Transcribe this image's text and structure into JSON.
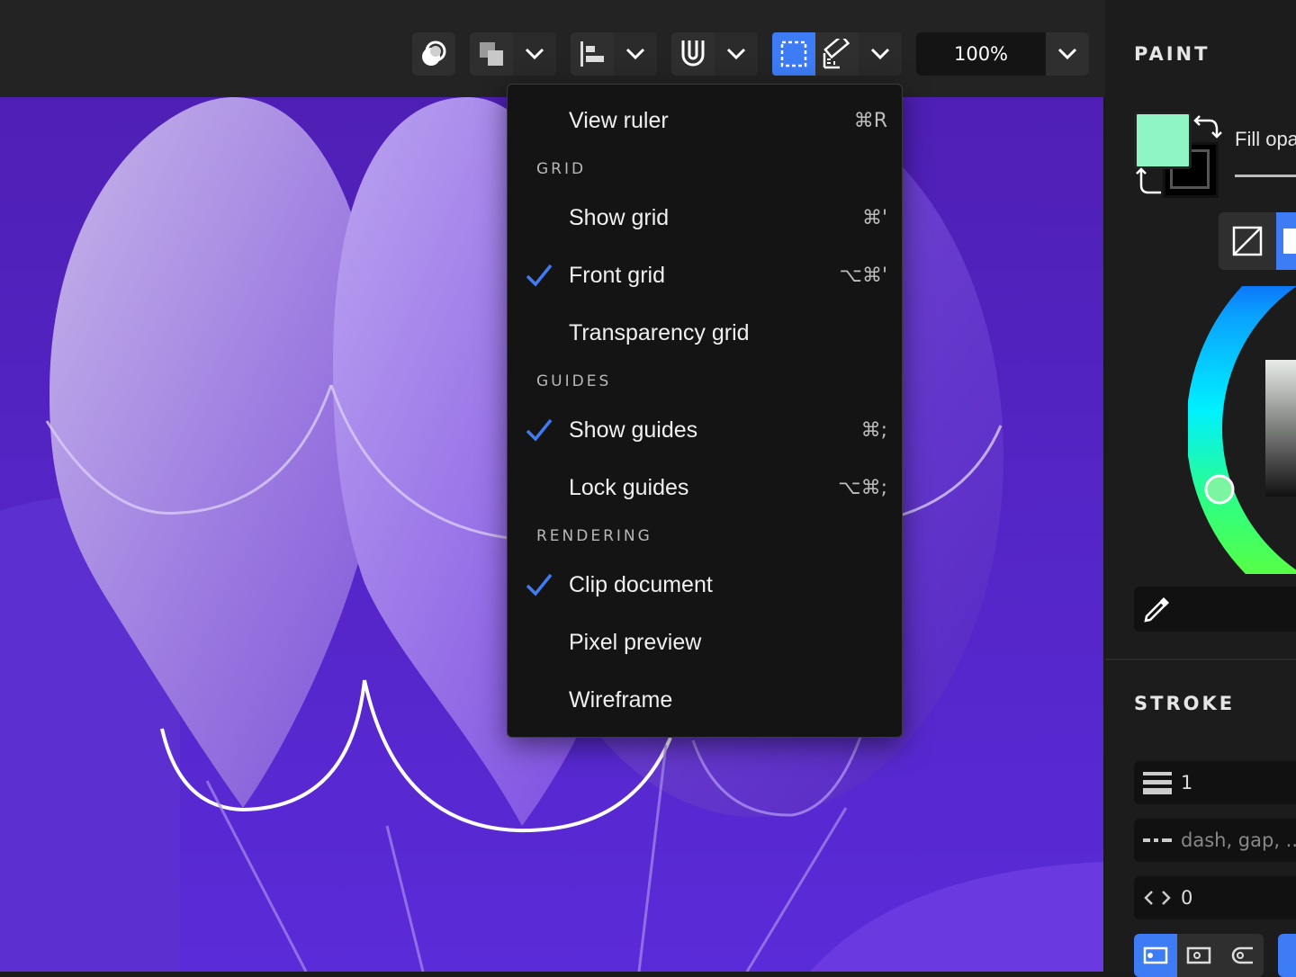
{
  "toolbar": {
    "zoom": "100%",
    "icons": [
      "boolean-icon",
      "arrange-icon",
      "align-icon",
      "snap-magnet-icon",
      "selection-icon",
      "ruler-icon"
    ]
  },
  "menu": {
    "items": [
      {
        "label": "View ruler",
        "shortcut": "⌘R",
        "checked": false
      },
      {
        "section": "GRID"
      },
      {
        "label": "Show grid",
        "shortcut": "⌘'",
        "checked": false
      },
      {
        "label": "Front grid",
        "shortcut": "⌥⌘'",
        "checked": true
      },
      {
        "label": "Transparency grid",
        "shortcut": "",
        "checked": false
      },
      {
        "section": "GUIDES"
      },
      {
        "label": "Show guides",
        "shortcut": "⌘;",
        "checked": true
      },
      {
        "label": "Lock guides",
        "shortcut": "⌥⌘;",
        "checked": false
      },
      {
        "section": "RENDERING"
      },
      {
        "label": "Clip document",
        "shortcut": "",
        "checked": true
      },
      {
        "label": "Pixel preview",
        "shortcut": "",
        "checked": false
      },
      {
        "label": "Wireframe",
        "shortcut": "",
        "checked": false
      }
    ]
  },
  "panel": {
    "paint_title": "PAINT",
    "fill_opacity_label": "Fill opa",
    "fill_color": "#8ff5c4",
    "stroke_title": "STROKE",
    "stroke_width": "1",
    "dash_placeholder": "dash, gap, ...",
    "offset": "0"
  },
  "colors": {
    "accent": "#3d7cf5",
    "canvas": "#5a2bd6"
  }
}
